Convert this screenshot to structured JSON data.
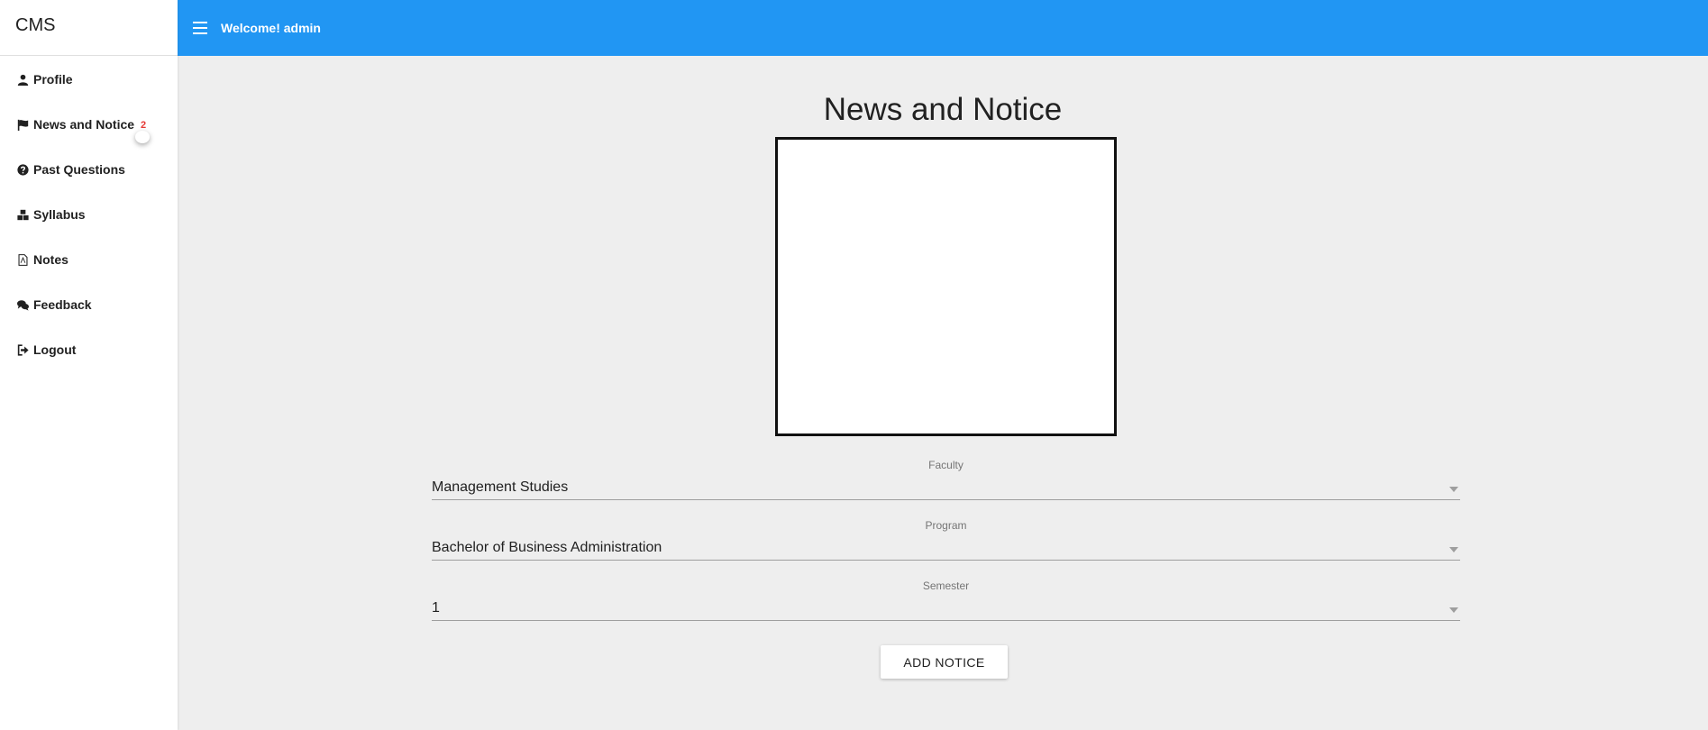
{
  "app": {
    "brand": "CMS"
  },
  "header": {
    "welcome": "Welcome! admin"
  },
  "sidebar": {
    "items": [
      {
        "label": "Profile",
        "icon": "user-icon"
      },
      {
        "label": "News and Notice",
        "icon": "flag-icon",
        "badge": "2"
      },
      {
        "label": "Past Questions",
        "icon": "question-circle-icon"
      },
      {
        "label": "Syllabus",
        "icon": "cubes-icon"
      },
      {
        "label": "Notes",
        "icon": "file-pdf-icon"
      },
      {
        "label": "Feedback",
        "icon": "comments-icon"
      },
      {
        "label": "Logout",
        "icon": "sign-out-icon"
      }
    ]
  },
  "main": {
    "title": "News and Notice",
    "fields": {
      "faculty": {
        "label": "Faculty",
        "value": "Management Studies"
      },
      "program": {
        "label": "Program",
        "value": "Bachelor of Business Administration"
      },
      "semester": {
        "label": "Semester",
        "value": "1"
      }
    },
    "add_button": "ADD NOTICE"
  },
  "colors": {
    "topbar": "#2196f3",
    "badge": "#e53935",
    "background": "#eeeeee"
  }
}
